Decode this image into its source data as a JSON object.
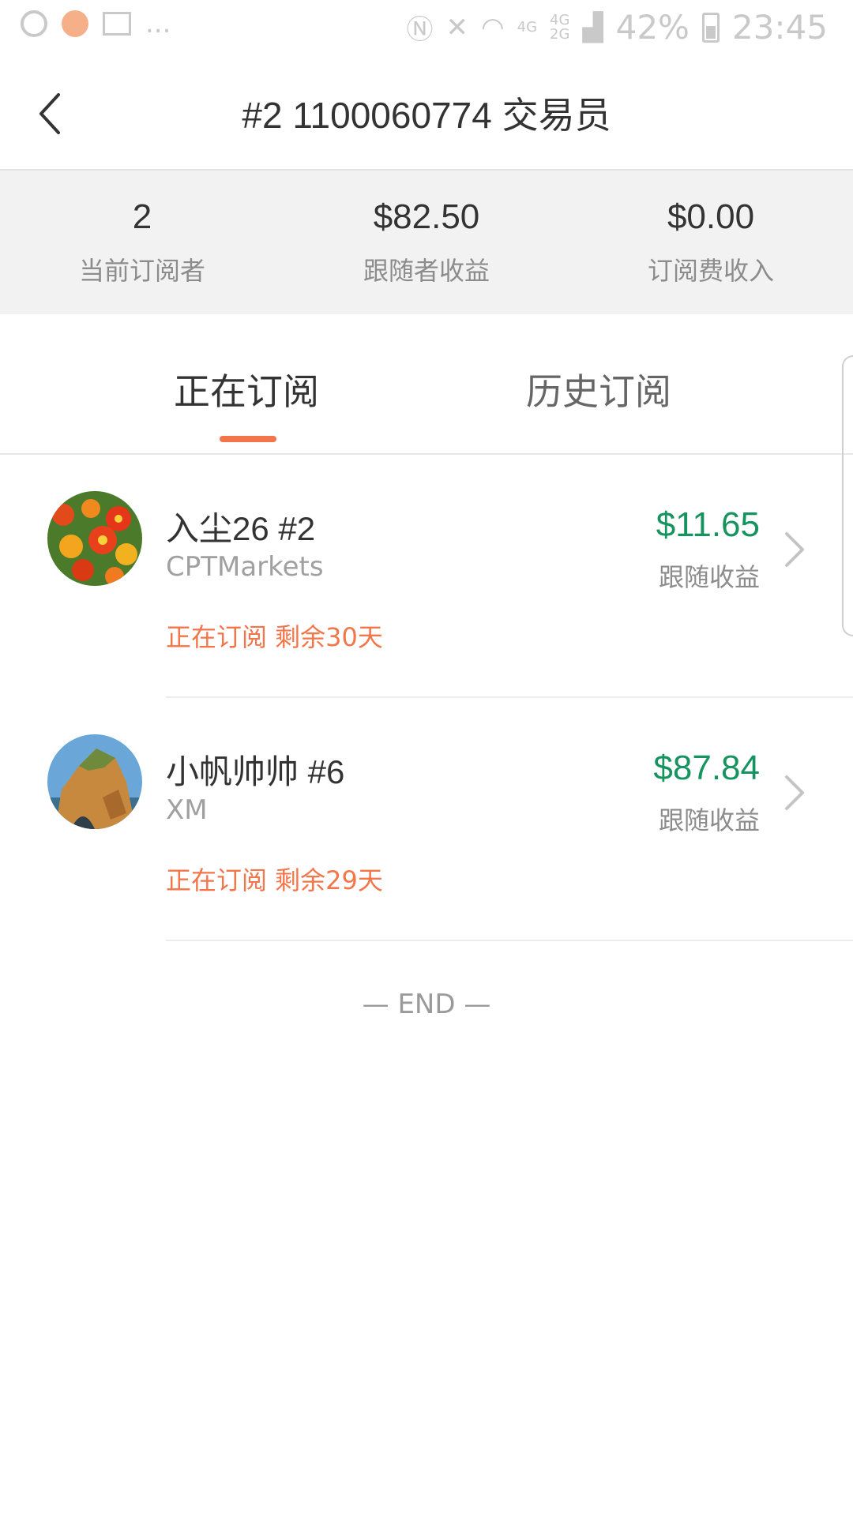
{
  "status_bar": {
    "left_more": "...",
    "network_4g": "4G",
    "network_4g2g_top": "4G",
    "network_4g2g_bottom": "2G",
    "battery_percent": "42%",
    "time": "23:45",
    "icons": [
      "sync-icon",
      "app-icon",
      "calendar-icon",
      "nfc-icon",
      "mute-icon",
      "wifi-icon",
      "signal-icon",
      "battery-icon"
    ]
  },
  "header": {
    "title": "#2 1100060774 交易员",
    "back_icon": "chevron-left-icon"
  },
  "stats": [
    {
      "value": "2",
      "label": "当前订阅者"
    },
    {
      "value": "$82.50",
      "label": "跟随者收益"
    },
    {
      "value": "$0.00",
      "label": "订阅费收入"
    }
  ],
  "tabs": {
    "active": "正在订阅",
    "inactive": "历史订阅"
  },
  "subscribers": [
    {
      "name": "入尘26 #2",
      "broker": "CPTMarkets",
      "status": "正在订阅 剩余30天",
      "earnings": "$11.65",
      "earnings_label": "跟随收益",
      "avatar": "flowers"
    },
    {
      "name": "小帆帅帅 #6",
      "broker": "XM",
      "status": "正在订阅 剩余29天",
      "earnings": "$87.84",
      "earnings_label": "跟随收益",
      "avatar": "rock"
    }
  ],
  "end_text": "— END —",
  "colors": {
    "accent": "#f3754a",
    "positive": "#17935f",
    "muted": "#8c8c8c"
  }
}
